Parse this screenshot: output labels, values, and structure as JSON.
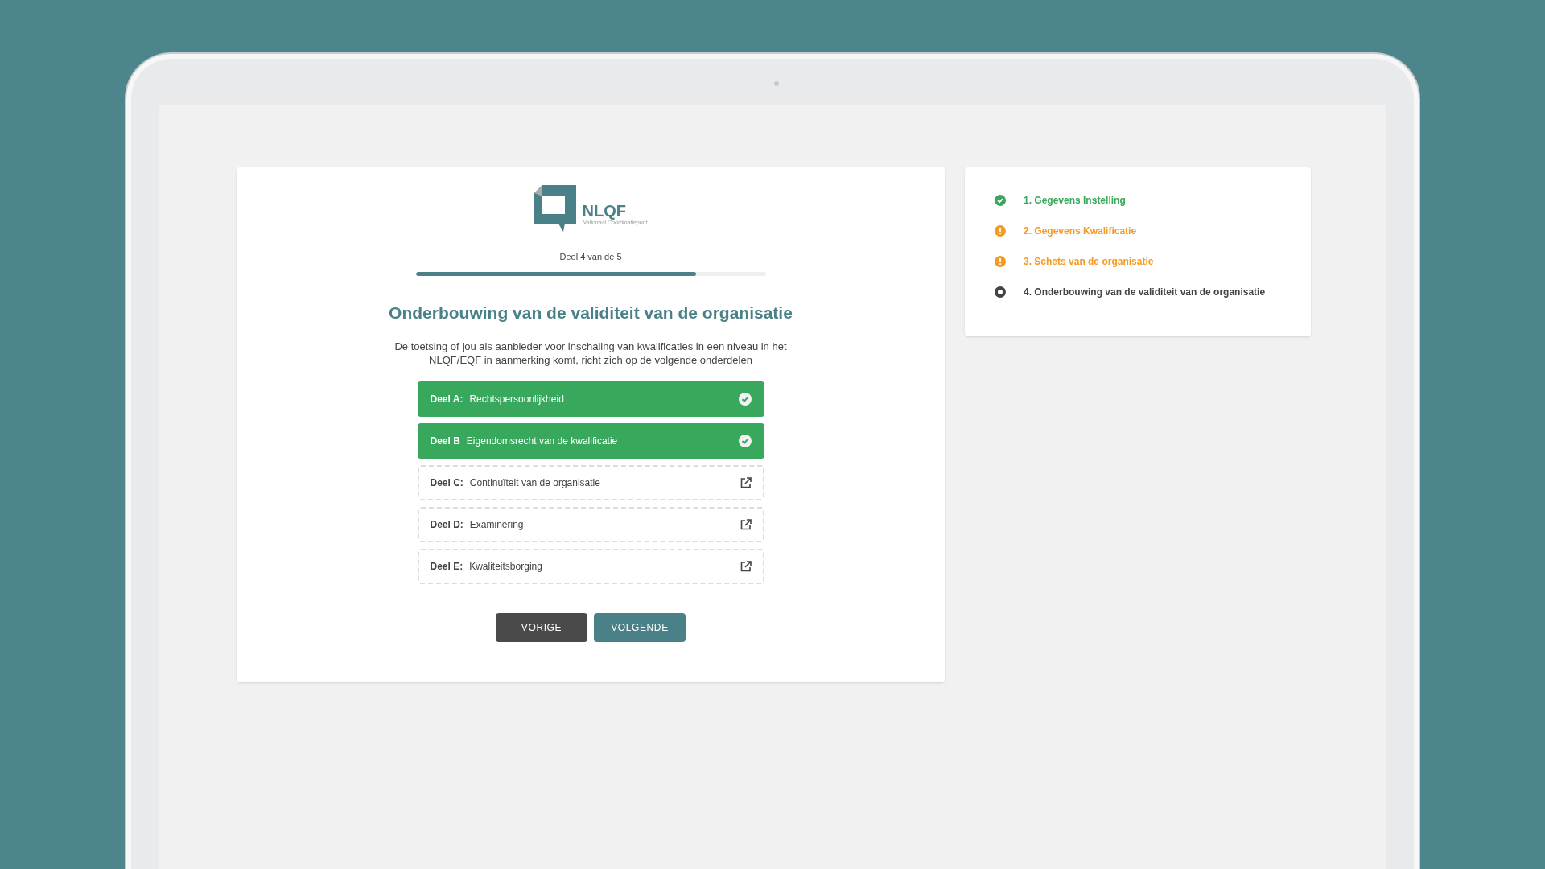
{
  "logo": {
    "name": "NLQF",
    "subtitle": "Nationaal Coördinatiepunt"
  },
  "progress": {
    "label": "Deel 4 van de 5",
    "level": 0.8
  },
  "title": "Onderbouwing van de validiteit van de organisatie",
  "intro": "De toetsing of jou als aanbieder voor inschaling van kwalificaties in een niveau in het NLQF/EQF in aanmerking komt, richt zich op de volgende onderdelen",
  "parts": [
    {
      "label": "Deel A:",
      "name": "Rechtspersoonlijkheid",
      "done": true
    },
    {
      "label": "Deel B",
      "name": "Eigendomsrecht van de kwalificatie",
      "done": true
    },
    {
      "label": "Deel C:",
      "name": "Continuïteit van de organisatie",
      "done": false
    },
    {
      "label": "Deel D:",
      "name": "Examinering",
      "done": false
    },
    {
      "label": "Deel E:",
      "name": "Kwaliteitsborging",
      "done": false
    }
  ],
  "buttons": [
    {
      "label": "VORIGE",
      "kind": "secondary"
    },
    {
      "label": "VOLGENDE",
      "kind": "primary"
    }
  ],
  "steps": [
    {
      "label": "1. Gegevens Instelling",
      "kind": "done"
    },
    {
      "label": "2. Gegevens Kwalificatie",
      "kind": "warning"
    },
    {
      "label": "3. Schets van de organisatie",
      "kind": "warning"
    },
    {
      "label": "4. Onderbouwing van de validiteit van de organisatie",
      "kind": "current"
    }
  ]
}
